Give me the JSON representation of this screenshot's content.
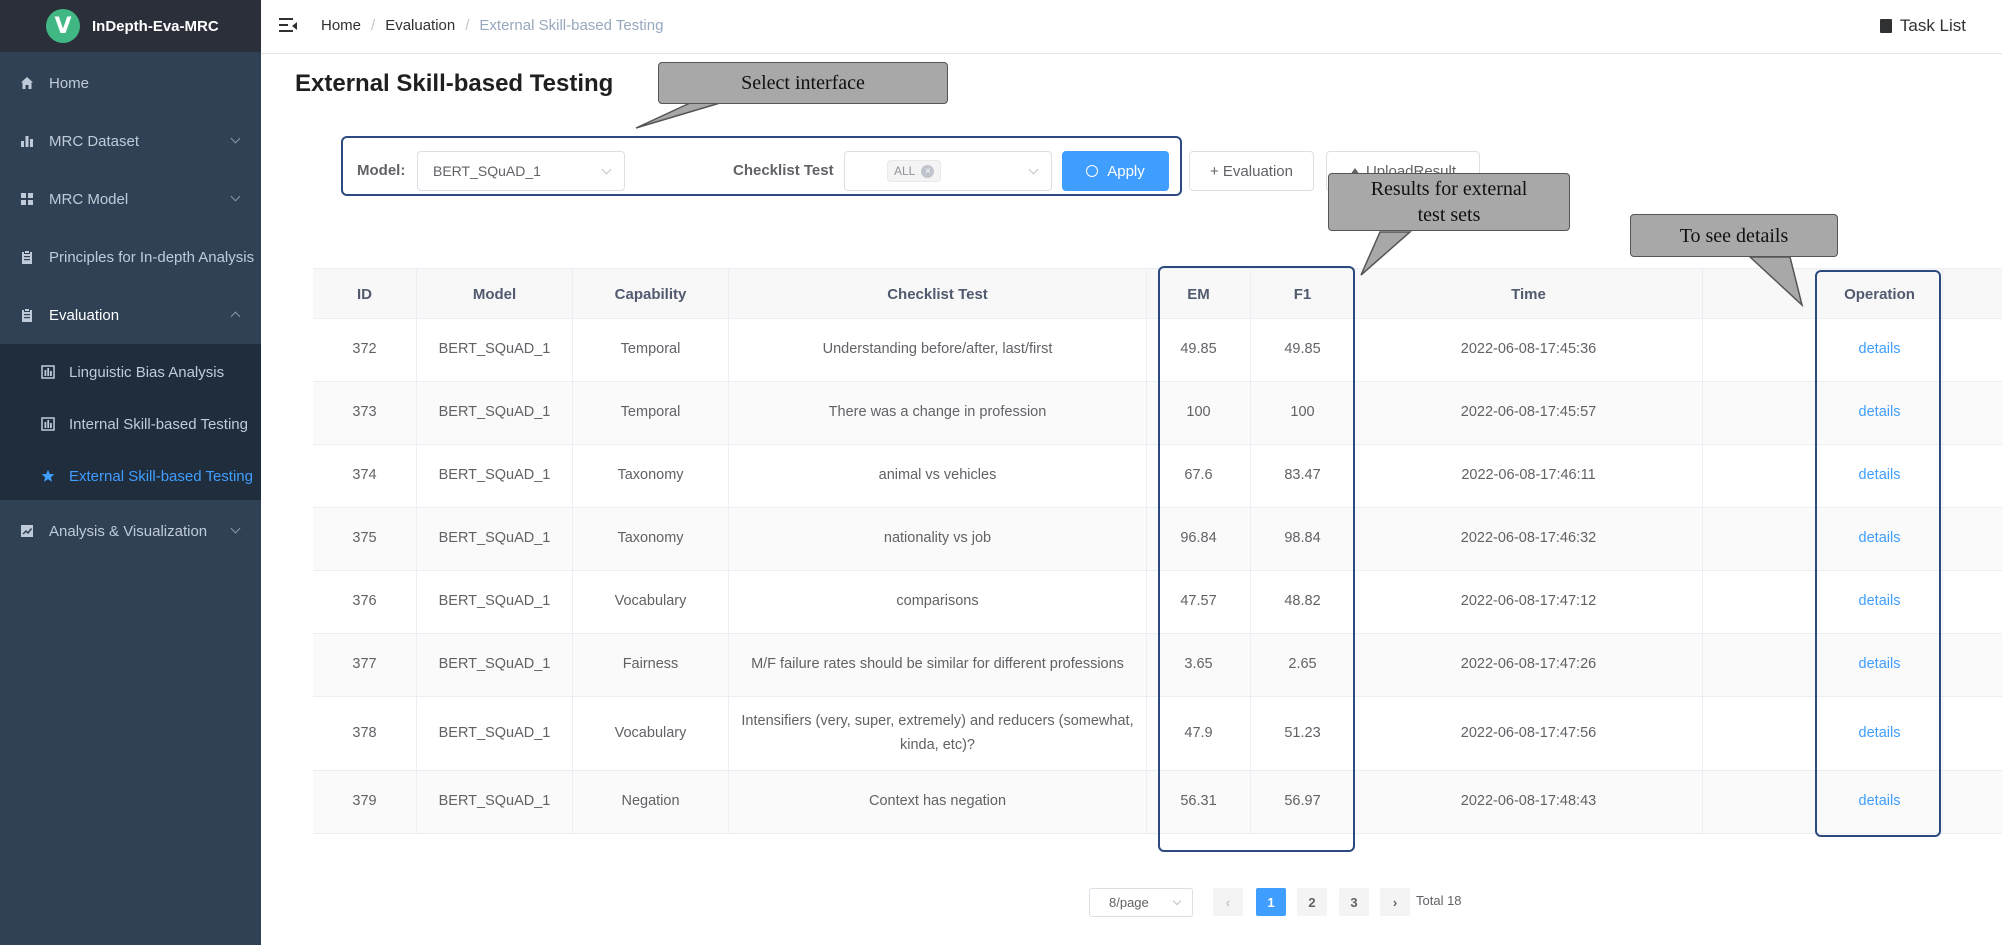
{
  "app": {
    "logo_letter": "V",
    "name": "InDepth-Eva-MRC"
  },
  "sidebar": {
    "items": [
      {
        "label": "Home",
        "icon": "home-icon"
      },
      {
        "label": "MRC Dataset",
        "icon": "bar-chart-icon"
      },
      {
        "label": "MRC Model",
        "icon": "grid-icon"
      },
      {
        "label": "Principles for In-depth Analysis",
        "icon": "clipboard-icon"
      },
      {
        "label": "Evaluation",
        "icon": "clipboard-icon"
      },
      {
        "label": "Analysis & Visualization",
        "icon": "line-chart-icon"
      }
    ],
    "evaluation_sub": [
      {
        "label": "Linguistic Bias Analysis",
        "icon": "bar-doc-icon"
      },
      {
        "label": "Internal Skill-based Testing",
        "icon": "bar-doc-icon"
      },
      {
        "label": "External Skill-based Testing",
        "icon": "star-icon"
      }
    ]
  },
  "header": {
    "breadcrumb": [
      "Home",
      "Evaluation",
      "External Skill-based Testing"
    ],
    "task_list": "Task List"
  },
  "page": {
    "title": "External Skill-based Testing"
  },
  "filters": {
    "model_label": "Model:",
    "model_value": "BERT_SQuAD_1",
    "checklist_label": "Checklist Test",
    "checklist_tag": "ALL",
    "apply_label": "Apply",
    "evaluation_label": "+ Evaluation",
    "upload_label": "UploadResult"
  },
  "table": {
    "columns": [
      "ID",
      "Model",
      "Capability",
      "Checklist Test",
      "EM",
      "F1",
      "Time",
      "",
      "Operation"
    ],
    "rows": [
      {
        "id": "372",
        "model": "BERT_SQuAD_1",
        "capability": "Temporal",
        "test": "Understanding before/after, last/first",
        "em": "49.85",
        "f1": "49.85",
        "time": "2022-06-08-17:45:36",
        "op": "details"
      },
      {
        "id": "373",
        "model": "BERT_SQuAD_1",
        "capability": "Temporal",
        "test": "There was a change in profession",
        "em": "100",
        "f1": "100",
        "time": "2022-06-08-17:45:57",
        "op": "details"
      },
      {
        "id": "374",
        "model": "BERT_SQuAD_1",
        "capability": "Taxonomy",
        "test": "animal vs vehicles",
        "em": "67.6",
        "f1": "83.47",
        "time": "2022-06-08-17:46:11",
        "op": "details"
      },
      {
        "id": "375",
        "model": "BERT_SQuAD_1",
        "capability": "Taxonomy",
        "test": "nationality vs job",
        "em": "96.84",
        "f1": "98.84",
        "time": "2022-06-08-17:46:32",
        "op": "details"
      },
      {
        "id": "376",
        "model": "BERT_SQuAD_1",
        "capability": "Vocabulary",
        "test": "comparisons",
        "em": "47.57",
        "f1": "48.82",
        "time": "2022-06-08-17:47:12",
        "op": "details"
      },
      {
        "id": "377",
        "model": "BERT_SQuAD_1",
        "capability": "Fairness",
        "test": "M/F failure rates should be similar for different professions",
        "em": "3.65",
        "f1": "2.65",
        "time": "2022-06-08-17:47:26",
        "op": "details"
      },
      {
        "id": "378",
        "model": "BERT_SQuAD_1",
        "capability": "Vocabulary",
        "test": "Intensifiers (very, super, extremely) and reducers (somewhat, kinda, etc)?",
        "em": "47.9",
        "f1": "51.23",
        "time": "2022-06-08-17:47:56",
        "op": "details"
      },
      {
        "id": "379",
        "model": "BERT_SQuAD_1",
        "capability": "Negation",
        "test": "Context has negation",
        "em": "56.31",
        "f1": "56.97",
        "time": "2022-06-08-17:48:43",
        "op": "details"
      }
    ]
  },
  "pagination": {
    "page_size": "8/page",
    "prev": "‹",
    "pages": [
      "1",
      "2",
      "3"
    ],
    "current": "1",
    "next": "›",
    "total": "Total 18"
  },
  "annotations": {
    "select_interface": "Select interface",
    "results": "Results for external test sets",
    "details": "To see details"
  },
  "colors": {
    "sidebar_bg": "#304156",
    "sidebar_active": "#409eff",
    "primary": "#409eff",
    "highlight_border": "#2c4a7e",
    "callout_fill": "#a8a8a8"
  }
}
